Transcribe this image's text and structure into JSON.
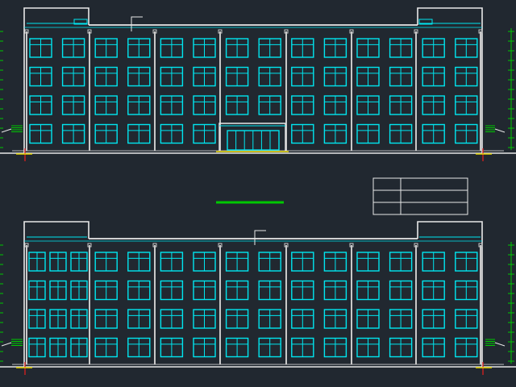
{
  "drawing": {
    "background": "#212830",
    "colors": {
      "outline": "#e8e8e8",
      "window": "#00e6f0",
      "dim_green": "#00c800",
      "marker_red": "#d02020",
      "marker_yellow": "#e0d000",
      "pilaster": "#c8c8c8"
    }
  },
  "elevations": [
    {
      "id": "front",
      "bays": 14,
      "floors": 4,
      "has_entrance": true,
      "triple_left_bays": false
    },
    {
      "id": "rear",
      "bays": 14,
      "floors": 4,
      "has_entrance": false,
      "triple_left_bays": true
    }
  ],
  "title_block": {
    "rows": 3,
    "cols": 2
  }
}
